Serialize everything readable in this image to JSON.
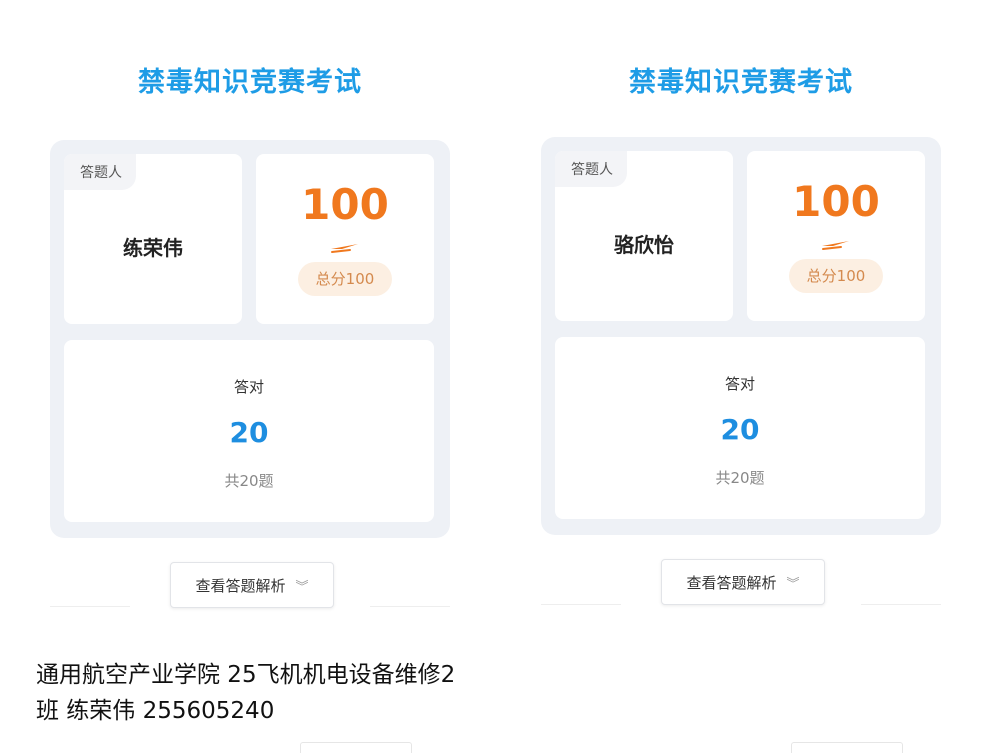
{
  "panels": [
    {
      "title": "禁毒知识竞赛考试",
      "respondent_label": "答题人",
      "respondent_name": "练荣伟",
      "score": "100",
      "total_score": "总分100",
      "correct_label": "答对",
      "correct_count": "20",
      "total_questions": "共20题",
      "review_button": "查看答题解析"
    },
    {
      "title": "禁毒知识竞赛考试",
      "respondent_label": "答题人",
      "respondent_name": "骆欣怡",
      "score": "100",
      "total_score": "总分100",
      "correct_label": "答对",
      "correct_count": "20",
      "total_questions": "共20题",
      "review_button": "查看答题解析"
    }
  ],
  "caption": "通用航空产业学院 25飞机机电设备维修2班 练荣伟 255605240",
  "colors": {
    "title": "#1e9ce6",
    "score": "#f0781e",
    "correct": "#1e8ee0",
    "card_bg": "#eef1f6"
  },
  "icons": {
    "review_chevron": "double-chevron-down-icon",
    "score_underline": "score-stroke-icon"
  }
}
